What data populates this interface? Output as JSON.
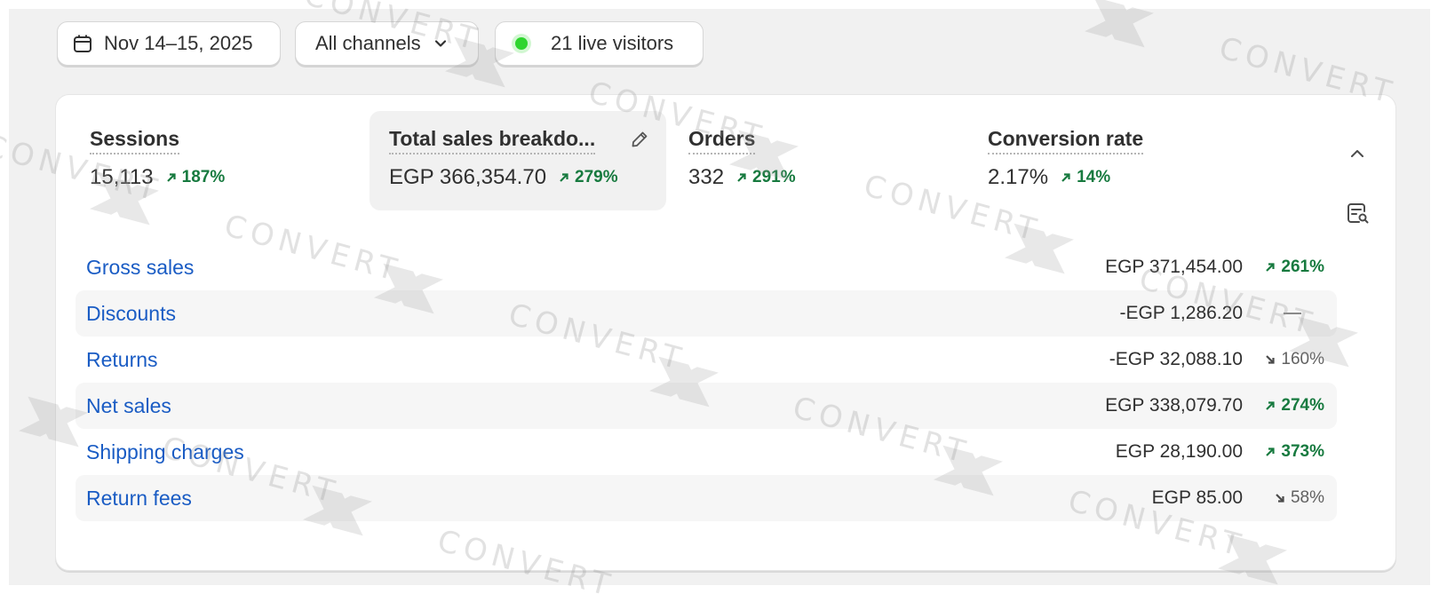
{
  "toolbar": {
    "date_range": "Nov 14–15, 2025",
    "channel": "All channels",
    "live_visitors": "21 live visitors",
    "live_color": "#2ed52e"
  },
  "metrics": [
    {
      "label": "Sessions",
      "value": "15,113",
      "change": "187%",
      "direction": "up"
    },
    {
      "label": "Total sales breakdo...",
      "value": "EGP 366,354.70",
      "change": "279%",
      "direction": "up",
      "selected": true
    },
    {
      "label": "Orders",
      "value": "332",
      "change": "291%",
      "direction": "up"
    },
    {
      "label": "Conversion rate",
      "value": "2.17%",
      "change": "14%",
      "direction": "up"
    }
  ],
  "breakdown": [
    {
      "label": "Gross sales",
      "amount": "EGP 371,454.00",
      "change": "261%",
      "direction": "up"
    },
    {
      "label": "Discounts",
      "amount": "-EGP 1,286.20",
      "change": "",
      "direction": "none"
    },
    {
      "label": "Returns",
      "amount": "-EGP 32,088.10",
      "change": "160%",
      "direction": "down"
    },
    {
      "label": "Net sales",
      "amount": "EGP 338,079.70",
      "change": "274%",
      "direction": "up"
    },
    {
      "label": "Shipping charges",
      "amount": "EGP 28,190.00",
      "change": "373%",
      "direction": "up"
    },
    {
      "label": "Return fees",
      "amount": "EGP 85.00",
      "change": "58%",
      "direction": "down"
    }
  ],
  "watermark": "CONVERT",
  "colors": {
    "link": "#1a5cc4",
    "positive": "#177a3f",
    "neutral": "#616161"
  },
  "icons": {
    "date": "calendar-icon",
    "channel": "chevron-down-icon",
    "edit": "pencil-icon",
    "collapse": "chevron-up-icon",
    "report": "report-search-icon",
    "trend_up": "arrow-up-right-icon",
    "trend_down": "arrow-down-right-icon"
  }
}
